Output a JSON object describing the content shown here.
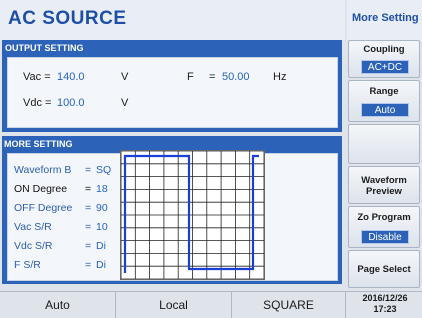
{
  "header": {
    "title": "AC SOURCE",
    "side_title": "More Setting"
  },
  "output_setting": {
    "label": "OUTPUT SETTING",
    "vac_label": "Vac =",
    "vac_value": "140.0",
    "vac_unit": "V",
    "f_label": "F",
    "f_eq": "=",
    "f_value": "50.00",
    "f_unit": "Hz",
    "vdc_label": "Vdc =",
    "vdc_value": "100.0",
    "vdc_unit": "V"
  },
  "more_setting": {
    "label": "MORE SETTING",
    "rows": [
      {
        "label": "Waveform B",
        "eq": "=",
        "value": "SQ"
      },
      {
        "label": "ON Degree",
        "eq": "=",
        "value": "18"
      },
      {
        "label": "OFF Degree",
        "eq": "=",
        "value": "90"
      },
      {
        "label": "Vac S/R",
        "eq": "=",
        "value": "10"
      },
      {
        "label": "Vdc S/R",
        "eq": "=",
        "value": "Di"
      },
      {
        "label": "F S/R",
        "eq": "=",
        "value": "Di"
      }
    ]
  },
  "soft_keys": {
    "coupling": {
      "label": "Coupling",
      "value": "AC+DC"
    },
    "range": {
      "label": "Range",
      "value": "Auto"
    },
    "waveform_preview": {
      "line1": "Waveform",
      "line2": "Preview"
    },
    "zo_program": {
      "label": "Zo Program",
      "value": "Disable"
    },
    "page_select": {
      "label": "Page Select"
    }
  },
  "status_bar": {
    "mode": "Auto",
    "control": "Local",
    "waveform": "SQUARE",
    "date": "2016/12/26",
    "time": "17:23"
  },
  "colors": {
    "accent": "#2c62b8",
    "title": "#1e4fa6",
    "value": "#2664c2",
    "wave": "#1a3fd6"
  }
}
